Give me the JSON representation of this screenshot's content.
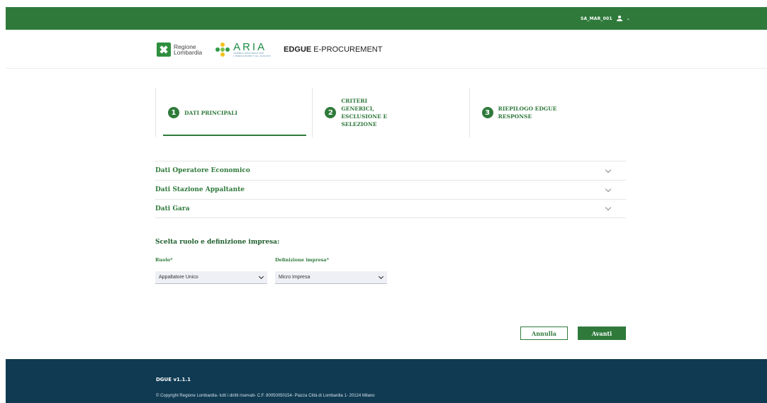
{
  "header": {
    "username": "SA_MAR_001",
    "brand": {
      "regione_line1": "Regione",
      "regione_line2": "Lombardia",
      "aria_word": "ARIA",
      "aria_sub1": "AZIENDA REGIONALE PER",
      "aria_sub2": "L'INNOVAZIONE E GLI ACQUISTI",
      "product_bold": "EDGUE",
      "product_rest": " E-PROCUREMENT"
    },
    "colors": {
      "topbar": "#2f7a3b",
      "accent": "#2f7a3b",
      "footer": "#0f3a52"
    }
  },
  "stepper": {
    "steps": [
      {
        "number": "1",
        "label": "DATI PRINCIPALI"
      },
      {
        "number": "2",
        "label": "CRITERI GENERICI, ESCLUSIONE E SELEZIONE"
      },
      {
        "number": "3",
        "label": "RIEPILOGO EDGUE RESPONSE"
      }
    ],
    "active_step": 1
  },
  "accordion": {
    "items": [
      {
        "title": "Dati Operatore Economico"
      },
      {
        "title": "Dati Stazione Appaltante"
      },
      {
        "title": "Dati Gara"
      }
    ]
  },
  "role_section": {
    "title": "Scelta ruolo e definizione impresa:",
    "role_label": "Ruolo*",
    "role_value": "Appaltatore Unico",
    "company_label": "Definizione impresa*",
    "company_value": "Micro Impresa"
  },
  "actions": {
    "cancel_label": "Annulla",
    "next_label": "Avanti"
  },
  "footer": {
    "version": "DGUE v1.1.1",
    "copyright": "© Copyright Regione Lombardia- tutti i diritti riservati- C.F. 80050050154- Piazza Città di Lombardia 1- 20124 Milano"
  }
}
